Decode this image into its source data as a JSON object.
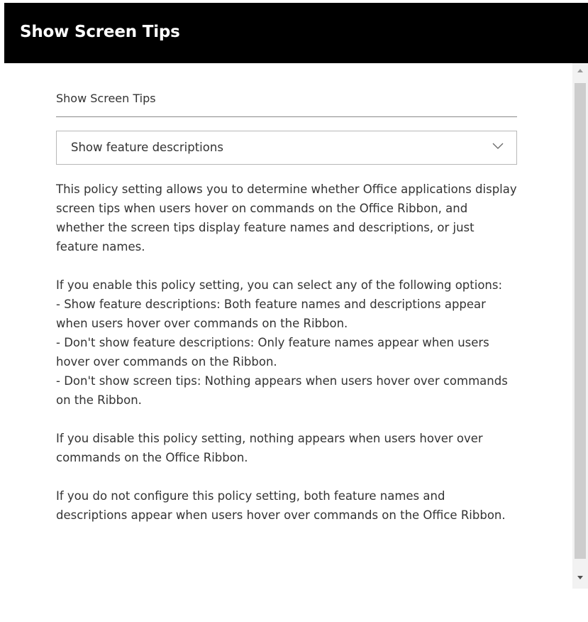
{
  "panel": {
    "title": "Show Screen Tips"
  },
  "setting": {
    "label": "Show Screen Tips",
    "dropdown_value": "Show feature descriptions",
    "description_paragraphs": [
      " This policy setting allows you to determine whether Office applications display screen tips when users hover on commands on the Office Ribbon, and whether the screen tips display feature names and descriptions, or just feature names.",
      "If you enable this policy setting, you can select any of the following options:\n- Show feature descriptions: Both feature names and descriptions appear when users hover over commands on the Ribbon.\n- Don't show feature descriptions: Only feature names appear when users hover over commands on the Ribbon.\n- Don't show screen tips: Nothing appears when users hover over commands on the Ribbon.",
      "If you disable this policy setting, nothing appears when users hover over commands on the Office Ribbon.",
      "If you do not configure this policy setting, both feature names and descriptions appear when users hover over commands on the Office Ribbon."
    ]
  },
  "icons": {
    "dropdown": "chevron-down-icon",
    "scroll_up": "scroll-up-arrow-icon",
    "scroll_down": "scroll-down-arrow-icon"
  },
  "colors": {
    "title_bar_bg": "#000000",
    "title_text": "#ffffff",
    "body_text": "#333333",
    "scrollbar_thumb": "#cdcdcd"
  }
}
